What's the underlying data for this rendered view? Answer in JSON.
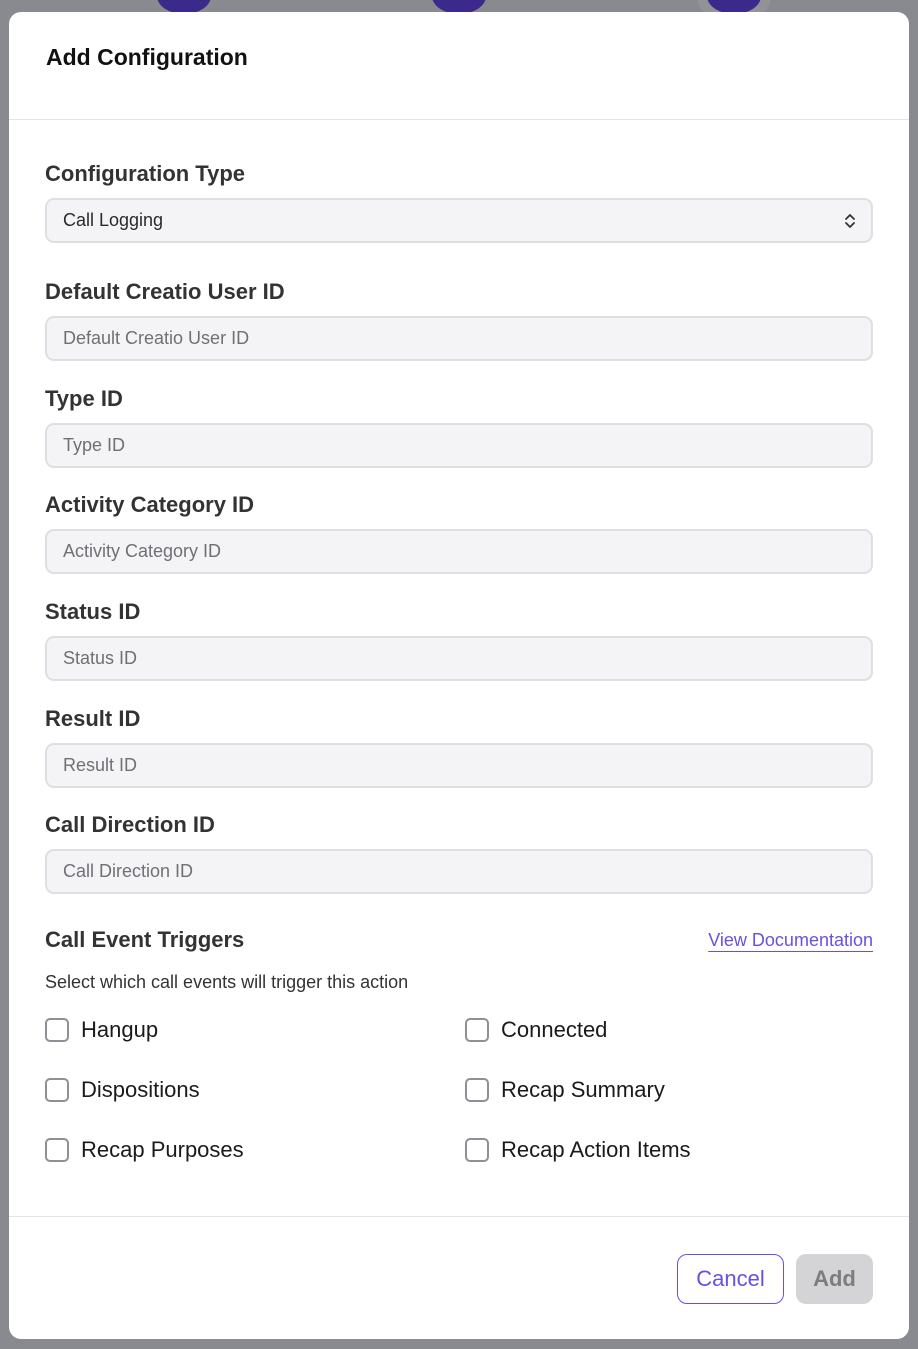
{
  "modal": {
    "title": "Add Configuration"
  },
  "fields": {
    "configuration_type": {
      "label": "Configuration Type",
      "value": "Call Logging"
    },
    "default_creatio_user_id": {
      "label": "Default Creatio User ID",
      "placeholder": "Default Creatio User ID",
      "value": ""
    },
    "type_id": {
      "label": "Type ID",
      "placeholder": "Type ID",
      "value": ""
    },
    "activity_category_id": {
      "label": "Activity Category ID",
      "placeholder": "Activity Category ID",
      "value": ""
    },
    "status_id": {
      "label": "Status ID",
      "placeholder": "Status ID",
      "value": ""
    },
    "result_id": {
      "label": "Result ID",
      "placeholder": "Result ID",
      "value": ""
    },
    "call_direction_id": {
      "label": "Call Direction ID",
      "placeholder": "Call Direction ID",
      "value": ""
    }
  },
  "triggers": {
    "title": "Call Event Triggers",
    "doc_link": "View Documentation",
    "subtitle": "Select which call events will trigger this action",
    "options": [
      {
        "label": "Hangup",
        "checked": false
      },
      {
        "label": "Connected",
        "checked": false
      },
      {
        "label": "Dispositions",
        "checked": false
      },
      {
        "label": "Recap Summary",
        "checked": false
      },
      {
        "label": "Recap Purposes",
        "checked": false
      },
      {
        "label": "Recap Action Items",
        "checked": false
      }
    ]
  },
  "footer": {
    "cancel_label": "Cancel",
    "add_label": "Add"
  },
  "colors": {
    "accent": "#6b4fe0",
    "backdrop": "#888a8f",
    "input_bg": "#f4f4f6",
    "disabled_button": "#d4d4d6"
  },
  "icons": {
    "select_indicator": "chevron-up-down-icon"
  }
}
